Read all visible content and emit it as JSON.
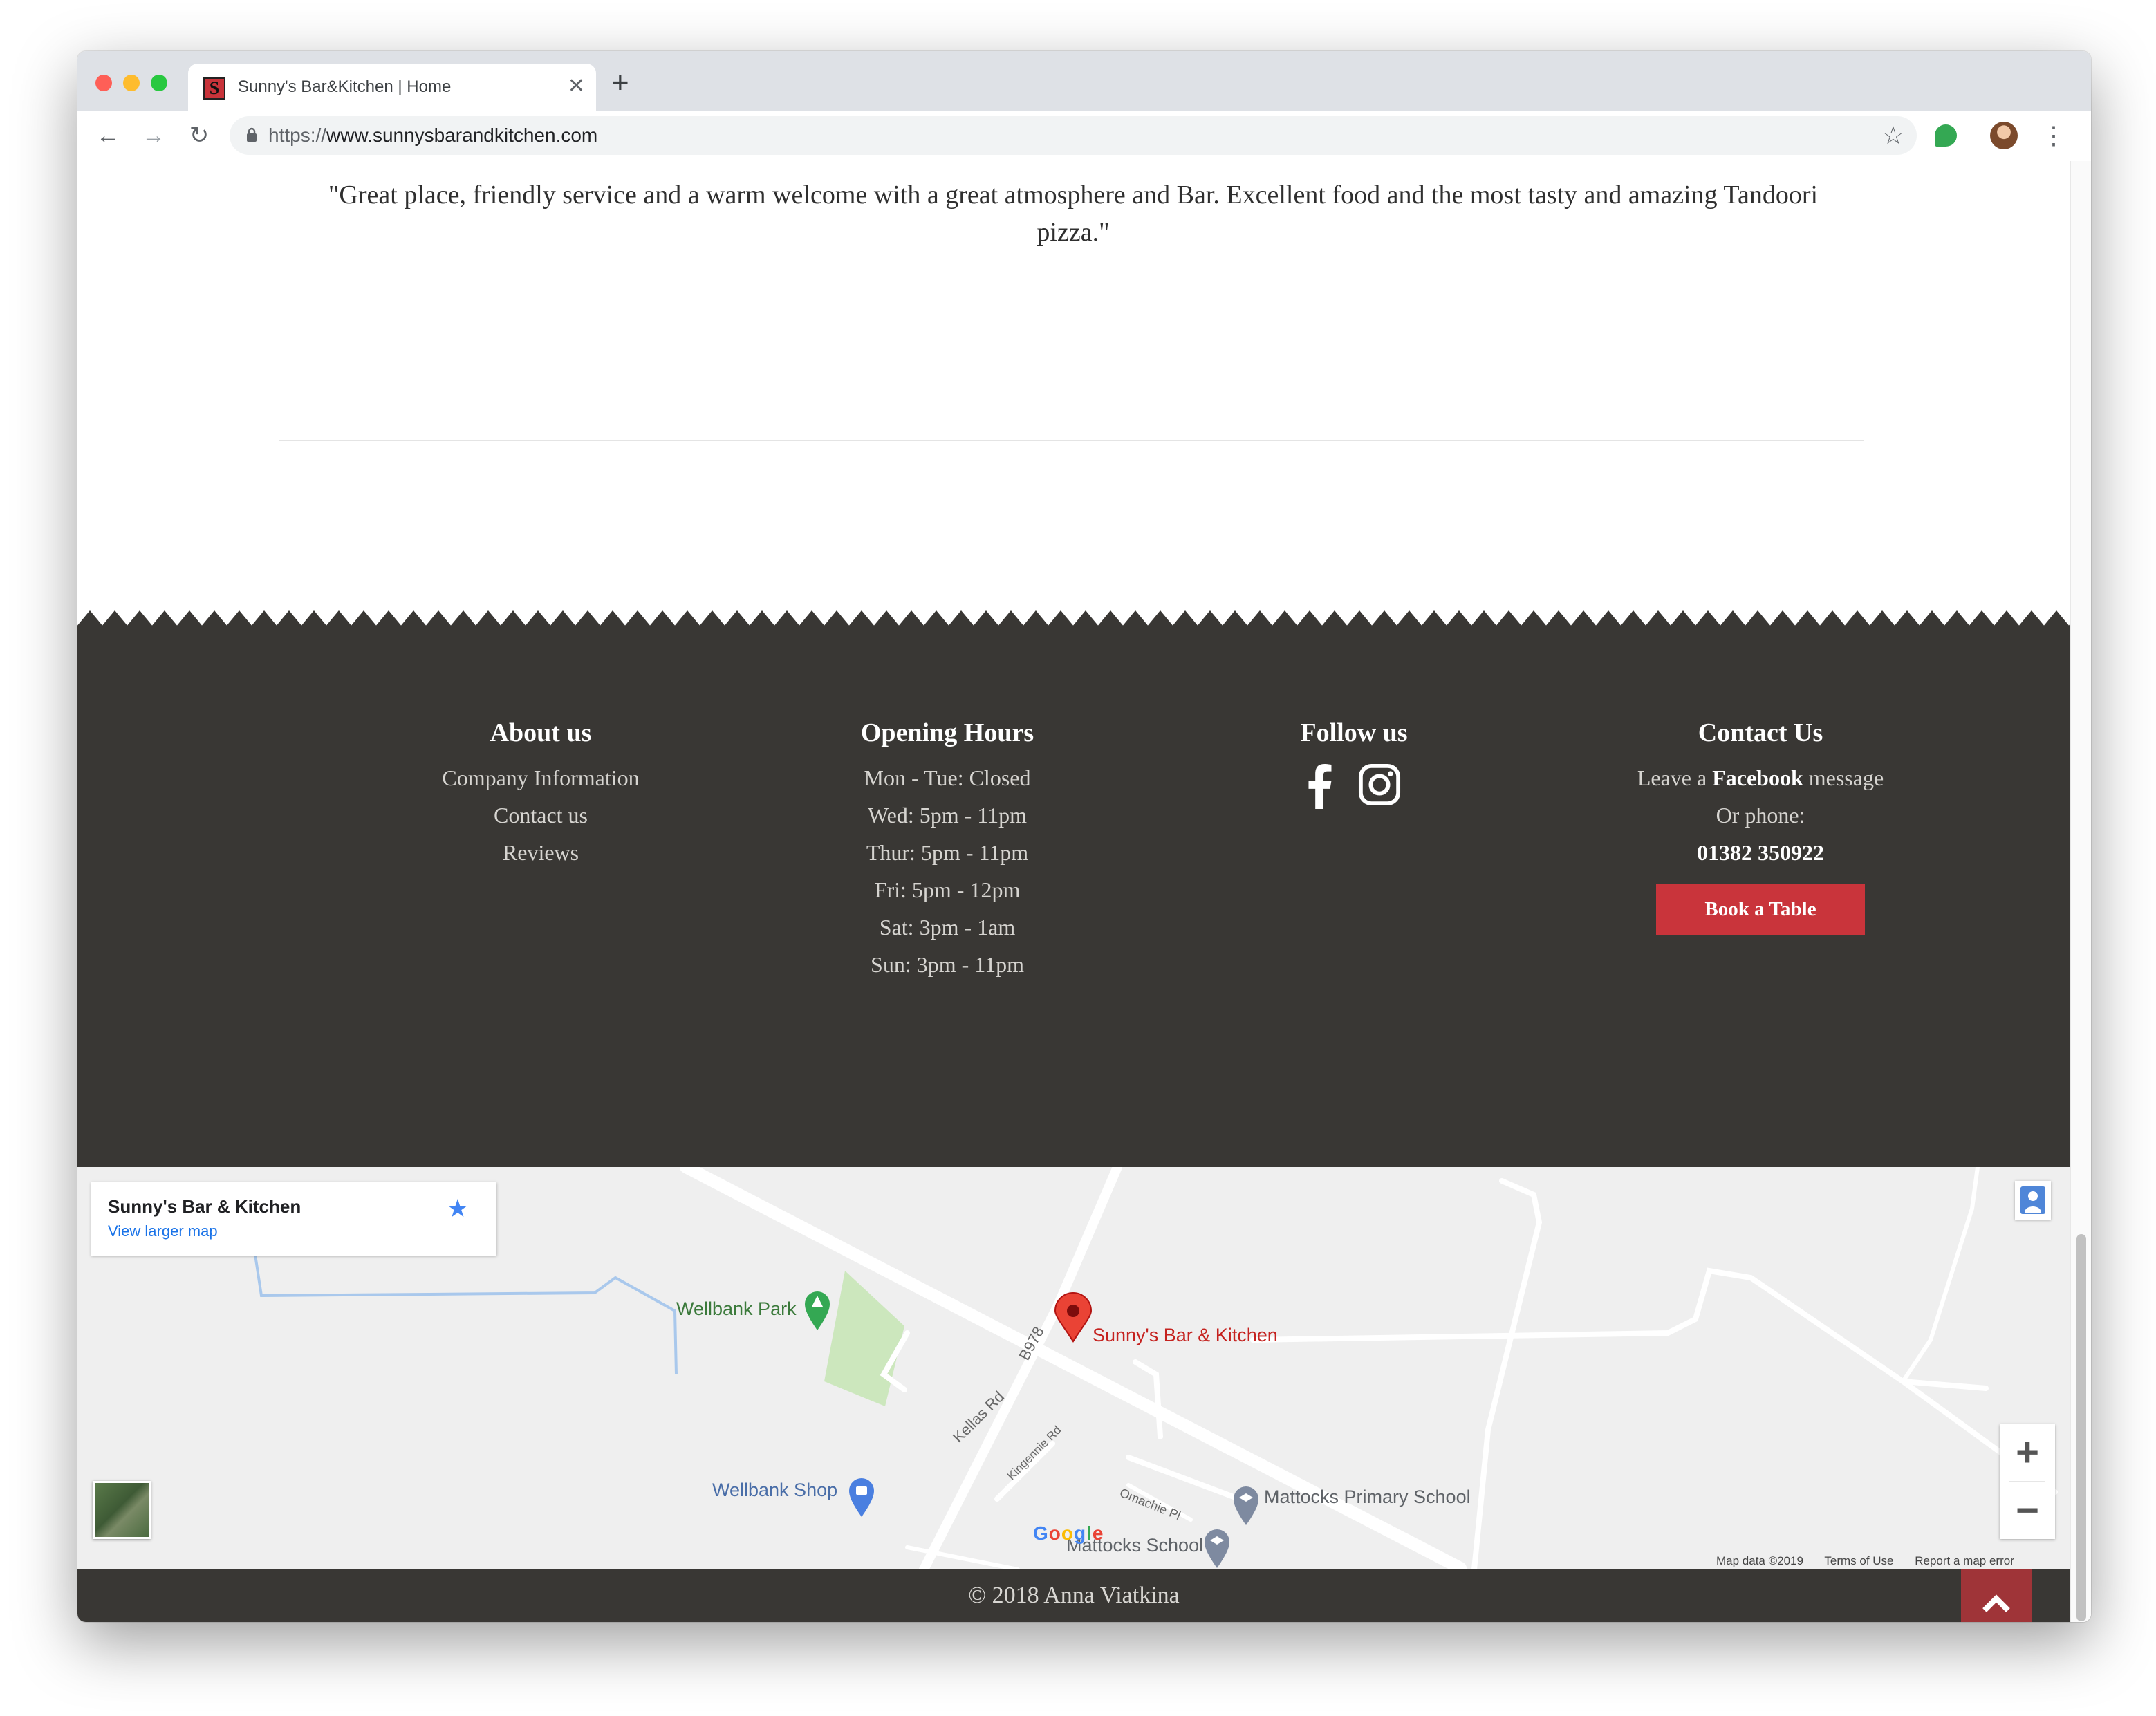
{
  "browser": {
    "tab_title": "Sunny's Bar&Kitchen | Home",
    "favicon_letter": "S",
    "close_glyph": "✕",
    "new_tab_glyph": "+",
    "url_scheme": "https://",
    "url_host": "www.sunnysbarandkitchen.com",
    "back_glyph": "←",
    "forward_glyph": "→",
    "reload_glyph": "↻",
    "bookmark_glyph": "☆",
    "menu_glyph": "⋮"
  },
  "testimonial": {
    "quote": "\"Great place, friendly service and a warm welcome with a great atmosphere and Bar. Excellent food and the most tasty and amazing Tandoori pizza.\""
  },
  "footer": {
    "about": {
      "heading": "About us",
      "links": [
        "Company Information",
        "Contact us",
        "Reviews"
      ]
    },
    "hours": {
      "heading": "Opening Hours",
      "lines": [
        "Mon - Tue: Closed",
        "Wed: 5pm - 11pm",
        "Thur: 5pm - 11pm",
        "Fri: 5pm - 12pm",
        "Sat: 3pm - 1am",
        "Sun: 3pm - 11pm"
      ]
    },
    "follow": {
      "heading": "Follow us",
      "icons": [
        "facebook-icon",
        "instagram-icon"
      ]
    },
    "contact": {
      "heading": "Contact Us",
      "leave_prefix": "Leave a ",
      "leave_bold": "Facebook",
      "leave_suffix": " message",
      "or_phone": "Or phone:",
      "phone": "01382 350922",
      "book_label": "Book a Table"
    }
  },
  "map": {
    "card_title": "Sunny's Bar & Kitchen",
    "card_link": "View larger map",
    "card_star": "★",
    "labels": {
      "park": "Wellbank Park",
      "place": "Sunny's Bar & Kitchen",
      "shop": "Wellbank Shop",
      "school1": "Mattocks Primary School",
      "school2": "Mattocks School",
      "road_b978": "B978",
      "road_kellas": "Kellas Rd",
      "road_kingennie": "Kingennie Rd",
      "road_omachie": "Omachie Pl"
    },
    "zoom_in": "+",
    "zoom_out": "−",
    "attribution": "Map data ©2019",
    "terms": "Terms of Use",
    "report": "Report a map error"
  },
  "page_footer": {
    "copyright": "© 2018 Anna Viatkina"
  },
  "colors": {
    "footer_bg": "#393734",
    "accent_red": "#c9343b",
    "to_top_bg": "#9f3438"
  }
}
